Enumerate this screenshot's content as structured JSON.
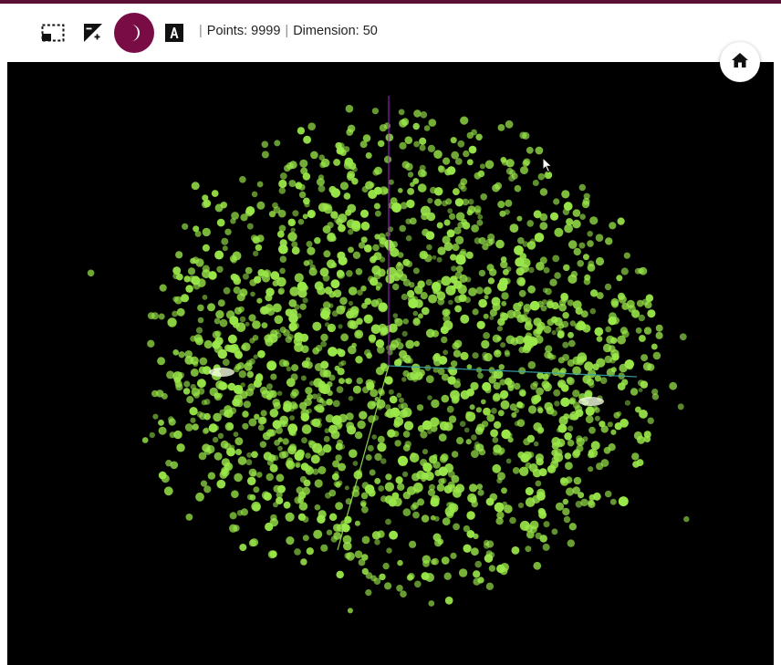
{
  "toolbar": {
    "points_label": "Points: 9999",
    "dimension_label": "Dimension: 50",
    "separator": "|",
    "tools": [
      {
        "icon": "selection-box-icon",
        "active": false
      },
      {
        "icon": "brightness-contrast-icon",
        "active": false
      },
      {
        "icon": "night-mode-moon-icon",
        "active": true
      },
      {
        "icon": "label-text-a-icon",
        "active": false
      }
    ]
  },
  "home_button": {
    "icon": "home-icon"
  },
  "colors": {
    "accent": "#7a0c45",
    "top_bar": "#5a0f34",
    "canvas_bg": "#000000",
    "point_color": "#9be84a",
    "axis_x": "#3aa6a8",
    "axis_y": "#a020c0",
    "axis_z": "#9be84a"
  },
  "chart_data": {
    "type": "scatter",
    "dimension": 50,
    "points_total": 9999,
    "projection": "3d"
  }
}
